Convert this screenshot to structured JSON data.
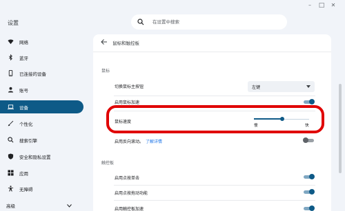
{
  "window": {
    "title": "设置",
    "minimize_glyph": "–",
    "maximize_glyph": "□",
    "close_glyph": "✕"
  },
  "search": {
    "placeholder": "在设置中搜索",
    "icon": "search-icon"
  },
  "sidebar": {
    "items": [
      {
        "label": "网络",
        "icon": "wifi-icon",
        "active": false
      },
      {
        "label": "蓝牙",
        "icon": "bluetooth-icon",
        "active": false
      },
      {
        "label": "已连接的设备",
        "icon": "phone-icon",
        "active": false
      },
      {
        "label": "账号",
        "icon": "person-icon",
        "active": false
      },
      {
        "label": "设备",
        "icon": "laptop-icon",
        "active": true
      },
      {
        "label": "个性化",
        "icon": "brush-icon",
        "active": false
      },
      {
        "label": "搜索引擎",
        "icon": "search-icon",
        "active": false
      },
      {
        "label": "安全和隐私设置",
        "icon": "shield-icon",
        "active": false
      },
      {
        "label": "应用",
        "icon": "apps-icon",
        "active": false
      },
      {
        "label": "无障碍",
        "icon": "accessibility-icon",
        "active": false
      }
    ],
    "advanced_label": "高级"
  },
  "page": {
    "title": "鼠标和触控板",
    "mouse_section": {
      "title": "鼠标",
      "primary_button_label": "切换鼠标主按钮",
      "primary_button_value": "左键",
      "acceleration_label": "启用鼠标加速",
      "acceleration_on": true,
      "speed_label": "鼠标速度",
      "speed_min_label": "慢",
      "speed_max_label": "快",
      "speed_fraction": 0.51,
      "reverse_scroll_label": "启用反向滚动。",
      "reverse_scroll_link": "了解详情",
      "reverse_scroll_on": false
    },
    "touchpad_section": {
      "title": "触控板",
      "tap_to_click_label": "启用点按单击",
      "tap_to_click_on": true,
      "tap_drag_label": "启用点按拖动功能",
      "tap_drag_on": true,
      "touchpad_accel_label": "启用触控板加速",
      "touchpad_accel_on": true
    }
  },
  "colors": {
    "accent": "#0e5a87",
    "highlight": "#e00000",
    "link": "#1a73e8"
  }
}
